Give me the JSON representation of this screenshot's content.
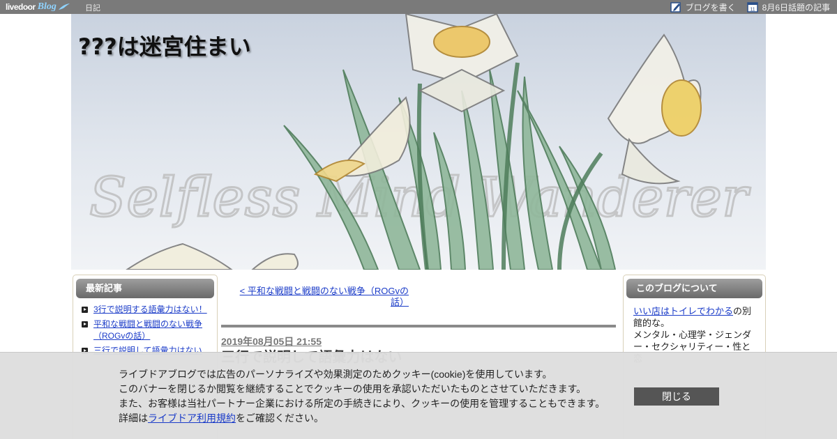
{
  "topbar": {
    "logo_main": "livedoor",
    "logo_blog": "Blog",
    "diary": "日記",
    "write_blog": "ブログを書く",
    "calendar_day": "11",
    "topic_articles": "8月6日話題の記事"
  },
  "header": {
    "blog_title": "???は迷宮住まい",
    "watermark": "Selfless Mind Wanderer"
  },
  "sidebar_left": {
    "heading": "最新記事",
    "items": [
      {
        "label": "3行で説明する語彙力はない！"
      },
      {
        "label": "平和な戦闘と戦闘のない戦争（ROGvの話）"
      },
      {
        "label": "三行で説明して語彙力はない"
      }
    ]
  },
  "sidebar_right": {
    "heading": "このブログについて",
    "link": "いい店はトイレでわかる",
    "text1": "の別館的な。",
    "text2": "メンタル・心理学・ジェンダー・セクシャリティー・性と恋"
  },
  "main": {
    "prev_link": "< 平和な戦闘と戦闘のない戦争（ROGvの話）",
    "post_date": "2019年08月05日 21:55",
    "post_title": "三行で説明して語彙力はない"
  },
  "cookie": {
    "line1": "ライブドアブログでは広告のパーソナライズや効果測定のためクッキー(cookie)を使用しています。",
    "line2": "このバナーを閉じるか閲覧を継続することでクッキーの使用を承認いただいたものとさせていただきます。",
    "line3": "また、お客様は当社パートナー企業における所定の手続きにより、クッキーの使用を管理することもできます。",
    "line4_prefix": "詳細は",
    "line4_link": "ライブドア利用規約",
    "line4_suffix": "をご確認ください。",
    "close_label": "閉じる"
  },
  "colors": {
    "topbar": "#7a7a7a",
    "link": "#1a3bc8",
    "close_button": "#555555"
  }
}
